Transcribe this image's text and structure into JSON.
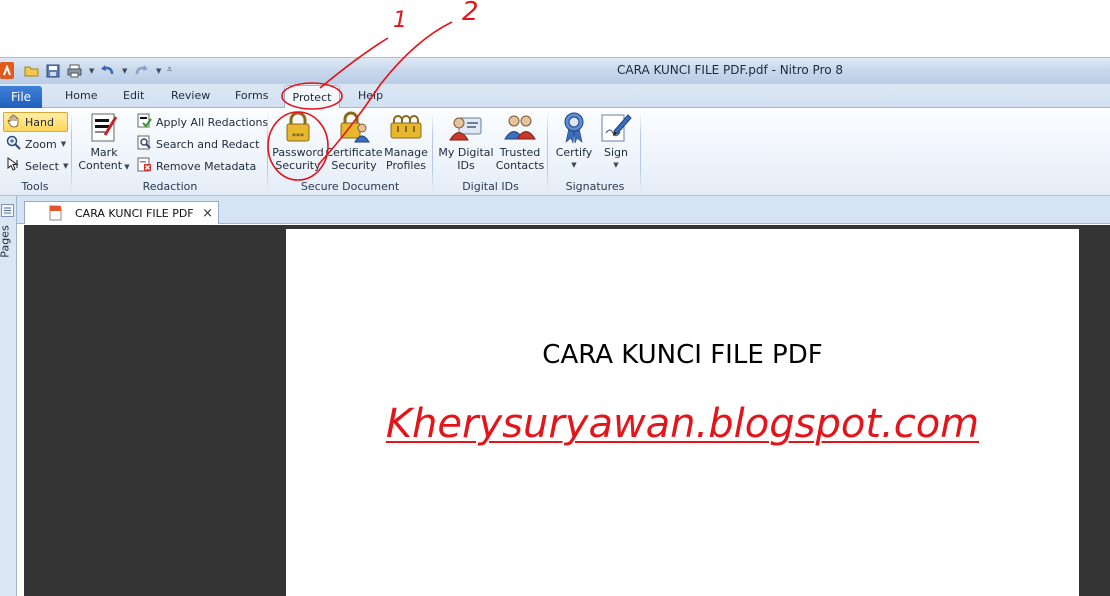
{
  "window": {
    "title": "CARA KUNCI FILE PDF.pdf - Nitro Pro 8"
  },
  "tabs": {
    "file": "File",
    "home": "Home",
    "edit": "Edit",
    "review": "Review",
    "forms": "Forms",
    "protect": "Protect",
    "help": "Help"
  },
  "ribbon": {
    "tools": {
      "label": "Tools",
      "hand": "Hand",
      "zoom": "Zoom",
      "select": "Select"
    },
    "redaction": {
      "label": "Redaction",
      "mark_content_line1": "Mark",
      "mark_content_line2": "Content",
      "apply_all": "Apply All Redactions",
      "search_redact": "Search and Redact",
      "remove_metadata": "Remove Metadata"
    },
    "secure_document": {
      "label": "Secure Document",
      "password_line1": "Password",
      "password_line2": "Security",
      "certificate_line1": "Certificate",
      "certificate_line2": "Security",
      "manage_line1": "Manage",
      "manage_line2": "Profiles"
    },
    "digital_ids": {
      "label": "Digital IDs",
      "my_ids_line1": "My Digital",
      "my_ids_line2": "IDs",
      "trusted_line1": "Trusted",
      "trusted_line2": "Contacts"
    },
    "signatures": {
      "label": "Signatures",
      "certify": "Certify",
      "sign": "Sign"
    }
  },
  "side_panel": {
    "pages": "Pages"
  },
  "document_tab": {
    "name": "CARA KUNCI FILE PDF",
    "close": "×"
  },
  "document": {
    "title": "CARA KUNCI FILE PDF",
    "url": "Kherysuryawan.blogspot.com"
  },
  "annotations": {
    "mark1": "1",
    "mark2": "2"
  },
  "colors": {
    "accent": "#1e5fbf",
    "annotation": "#e3141a",
    "viewer_bg": "#343434"
  }
}
